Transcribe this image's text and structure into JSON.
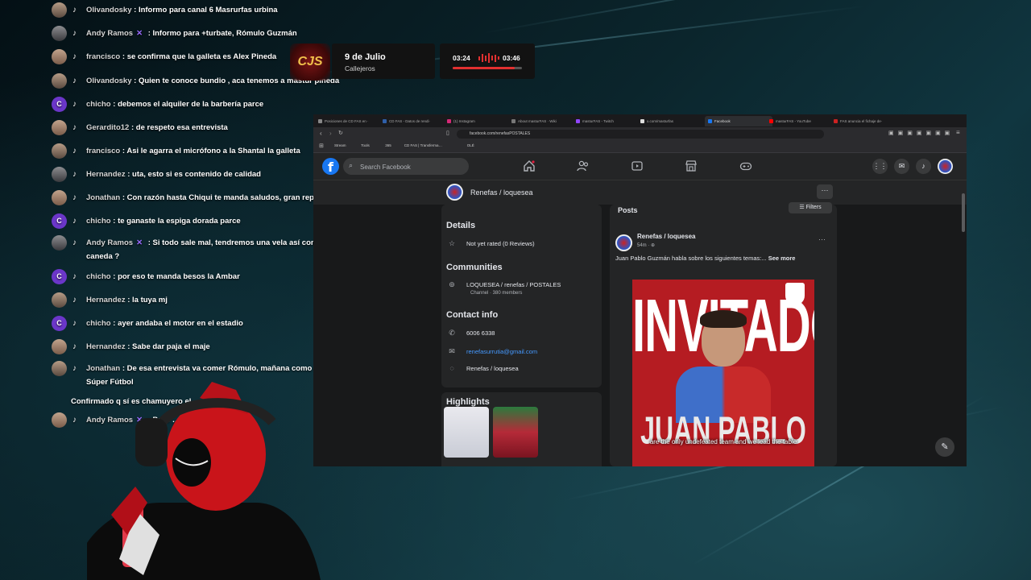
{
  "chat": [
    {
      "avatar": "photo",
      "name": "Olivandosky",
      "badge": "",
      "text": ": Informo para canal 6 Masrurfas urbina"
    },
    {
      "avatar": "photo",
      "name": "Andy Ramos",
      "badge": "✕",
      "text": ": Informo para +turbate, Rómulo Guzmán"
    },
    {
      "avatar": "photo",
      "name": "francisco",
      "badge": "",
      "text": ": se confirma que la galleta es Alex Pineda"
    },
    {
      "avatar": "photo",
      "name": "Olivandosky",
      "badge": "",
      "text": ": Quien te conoce bundio , aca tenemos a mastur pineda"
    },
    {
      "avatar": "C",
      "name": "chicho",
      "badge": "",
      "text": ": debemos el alquiler de la barbería parce"
    },
    {
      "avatar": "photo",
      "name": "Gerardito12",
      "badge": "",
      "text": ": de respeto esa entrevista"
    },
    {
      "avatar": "photo",
      "name": "francisco",
      "badge": "",
      "text": ": Asi le agarra el micrófono a la Shantal la galleta"
    },
    {
      "avatar": "photo",
      "name": "Hernandez",
      "badge": "",
      "text": ": uta, esto si es contenido de calidad"
    },
    {
      "avatar": "photo",
      "name": "Jonathan",
      "badge": "",
      "text": ": Con razón hasta Chiqui te manda saludos, gran reportaje"
    },
    {
      "avatar": "C",
      "name": "chicho",
      "badge": "",
      "text": ": te ganaste la espiga dorada parce"
    },
    {
      "avatar": "photo",
      "name": "Andy Ramos",
      "badge": "✕",
      "text": ": Si todo sale mal, tendremos una vela así como la de caneda ?"
    },
    {
      "avatar": "C",
      "name": "chicho",
      "badge": "",
      "text": ": por eso te manda besos la Ambar"
    },
    {
      "avatar": "photo",
      "name": "Hernandez",
      "badge": "",
      "text": ": la tuya mj"
    },
    {
      "avatar": "C",
      "name": "chicho",
      "badge": "",
      "text": ": ayer andaba el motor en el estadio"
    },
    {
      "avatar": "photo",
      "name": "Hernandez",
      "badge": "",
      "text": ": Sabe dar paja el maje"
    },
    {
      "avatar": "photo",
      "name": "Jonathan",
      "badge": "",
      "text": ": De esa entrevista va comer Rómulo, mañana como exclusiva en Súper Fútbol"
    },
    {
      "avatar": "",
      "name": "",
      "badge": "",
      "text": "Confirmado q sí es chamuyero el"
    },
    {
      "avatar": "photo",
      "name": "Andy Ramos",
      "badge": "✕",
      "text": ": Po… …cionalizar Murillo ?"
    }
  ],
  "scoreboard": {
    "logo_text": "CJS",
    "date": "9 de Julio",
    "subtitle": "Callejeros",
    "time_elapsed": "03:24",
    "time_total": "03:46",
    "progress": 0.9
  },
  "browser": {
    "tabs": [
      {
        "label": "Posiciones de CD FAS en ·"
      },
      {
        "label": "CD FAS - Datos de rendi·"
      },
      {
        "label": "(1) Instagram"
      },
      {
        "label": "About masturFAS · Wiki"
      },
      {
        "label": "masturFAS - Twitch"
      },
      {
        "label": "x.com/masturfas"
      },
      {
        "label": "Facebook"
      },
      {
        "label": "masturFAS - YouTube"
      },
      {
        "label": "FAS anuncia el fichaje de·"
      }
    ],
    "url": "facebook.com/renefasPOSTALES",
    "bookmarks": [
      "Stream",
      "Tools",
      "365",
      "CD FAS | Transferma…",
      "OLÉ"
    ]
  },
  "facebook": {
    "search_placeholder": "Search Facebook",
    "page_name": "Renefas / loquesea",
    "details_heading": "Details",
    "rating": "Not yet rated (0 Reviews)",
    "communities_heading": "Communities",
    "community_name": "LOQUESEA / renefas / POSTALES",
    "community_sub": "Channel · 380 members",
    "contact_heading": "Contact info",
    "phone": "6006 6338",
    "email": "renefasurrutia@gmail.com",
    "messenger": "Renefas / loquesea",
    "highlights_heading": "Highlights",
    "posts_heading": "Posts",
    "filters_label": "Filters",
    "post": {
      "author": "Renefas / loquesea",
      "time": "54m · ⊕",
      "text": "Juan Pablo Guzmán habla sobre los siguientes temas:...",
      "see_more": "See more",
      "image_title": "INVITADO",
      "image_name": "JUAN PABLO"
    }
  },
  "caption": "are the only undefeated team and we lead the table",
  "colors": {
    "fb_blue": "#1877f2",
    "accent_red": "#e23030",
    "post_red": "#b51c22"
  }
}
